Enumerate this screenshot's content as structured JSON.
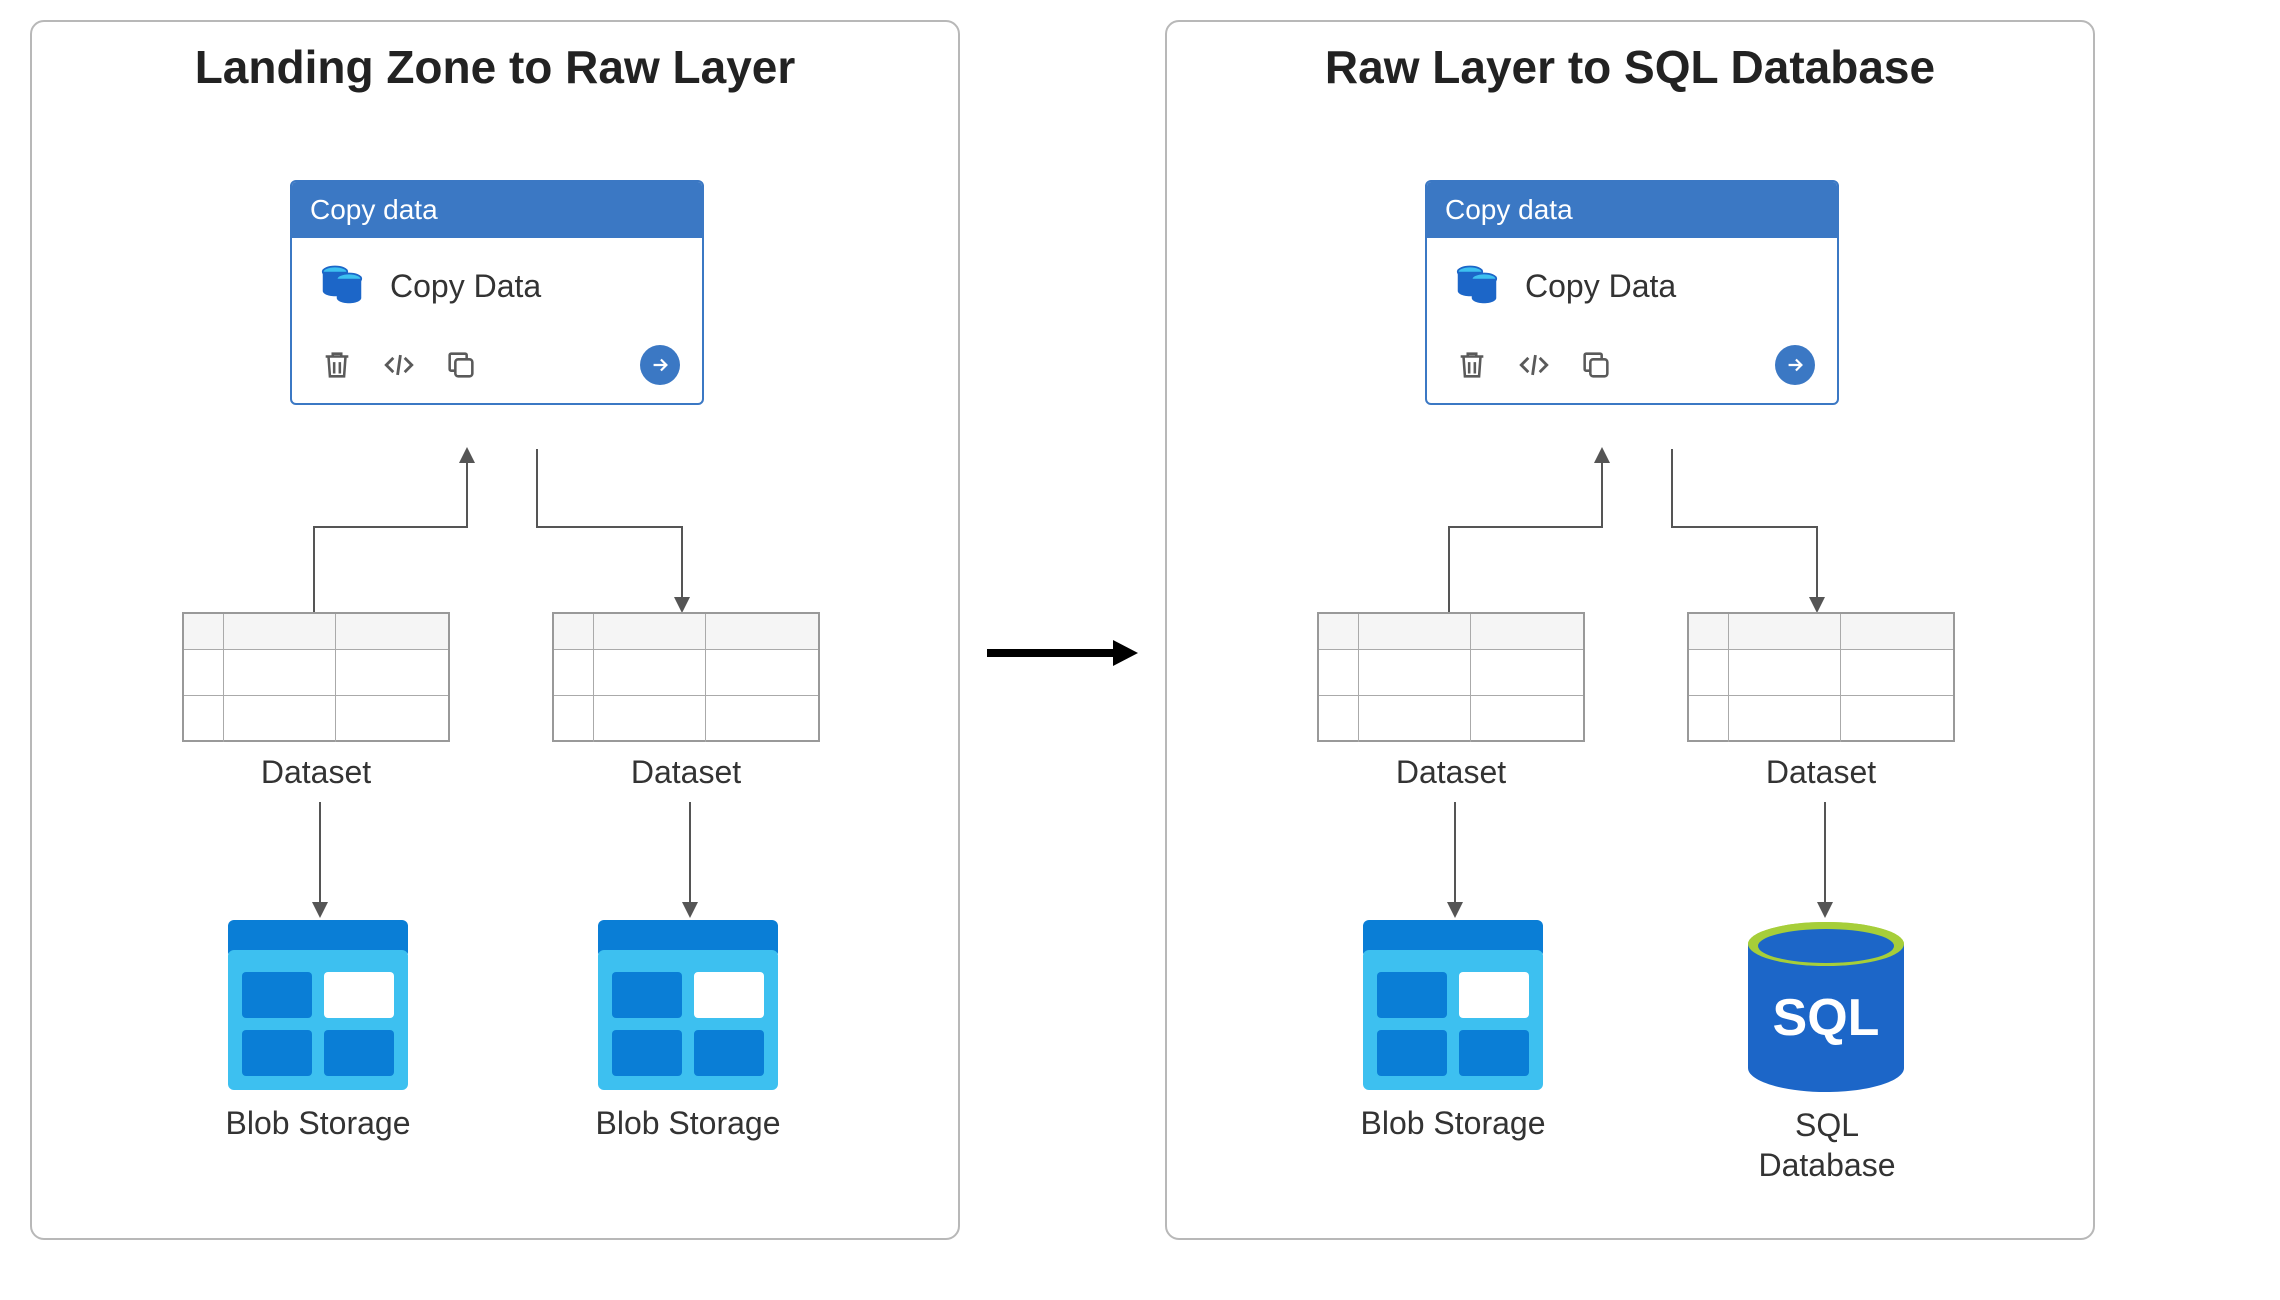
{
  "colors": {
    "panel_border": "#b8b8b8",
    "card_blue": "#3b78c4",
    "blob_dark": "#0a7ed6",
    "blob_light": "#3dc0f0",
    "blob_tile": "#0a7ed6",
    "sql_blue": "#1c66c8",
    "sql_green": "#a6ce39"
  },
  "panels": {
    "left": {
      "title": "Landing Zone to Raw Layer",
      "card": {
        "header": "Copy data",
        "body": "Copy Data"
      },
      "source": {
        "dataset_label": "Dataset",
        "store_label": "Blob Storage",
        "store_type": "blob"
      },
      "sink": {
        "dataset_label": "Dataset",
        "store_label": "Blob Storage",
        "store_type": "blob"
      }
    },
    "right": {
      "title": "Raw Layer to SQL Database",
      "card": {
        "header": "Copy data",
        "body": "Copy Data"
      },
      "source": {
        "dataset_label": "Dataset",
        "store_label": "Blob Storage",
        "store_type": "blob"
      },
      "sink": {
        "dataset_label": "Dataset",
        "store_label": "SQL\nDatabase",
        "store_type": "sql"
      }
    }
  },
  "icons": {
    "trash": "trash-icon",
    "code": "code-icon",
    "clone": "clone-icon",
    "run": "arrow-right-circle-icon",
    "copy_data": "database-copy-icon",
    "dataset": "table-grid-icon",
    "blob": "azure-blob-storage-icon",
    "sql": "azure-sql-database-icon"
  }
}
